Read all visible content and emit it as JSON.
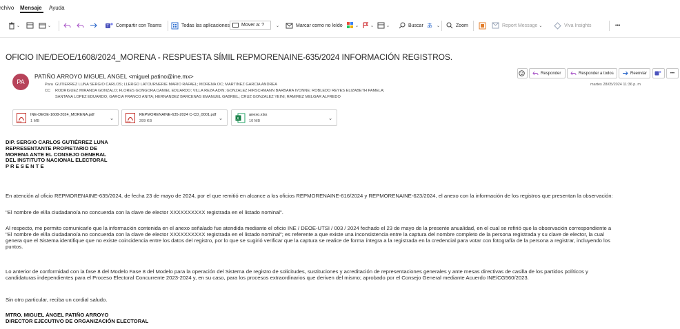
{
  "menu": {
    "items": [
      "rchivo",
      "Mensaje",
      "Ayuda"
    ]
  },
  "ribbon": {
    "teams": "Compartir con Teams",
    "apps": "Todas las aplicaciones",
    "move": "Mover a: ?",
    "mark": "Marcar como no leído",
    "search": "Buscar",
    "zoom": "Zoom",
    "report": "Report Message",
    "insights": "Viva Insights",
    "more": "•••"
  },
  "email": {
    "subject": "OFICIO INE/DEOE/1608/2024_MORENA - RESPUESTA SÍMIL REPMORENAINE-635/2024 INFORMACIÓN REGISTROS.",
    "avatar_initials": "PA",
    "from": "PATIÑO ARROYO MIGUEL ANGEL <miguel.patino@ine.mx>",
    "to_label": "Para",
    "to": "GUTIERREZ LUNA SERGIO CARLOS; LLERGO LATOURNERIE MARIO RAFAEL; MORENA OC; MARTINEZ GARCIA ANDREA",
    "cc_label": "CC",
    "cc_line1": "RODRIGUEZ MIRANDA GONZALO; FLORES GONGORA DANIEL EDUARDO; VILLA REZA ADIN; GONZALEZ HIRSCHMANN BARBARA IVONNE; ROBLEDO REYES ELIZABETH PAMELA;",
    "cc_line2": "SANTANA LOPEZ EDUARDO; GARCIA FRANCO ANITA; HERNANDEZ BARCENAS EMANUEL GABRIEL; CRUZ GONZALEZ YEINI; RAMIREZ MELGAR ALFREDO",
    "datetime": "martes 28/05/2024 11:36 p. m",
    "actions": {
      "reply": "Responder",
      "reply_all": "Responder a todos",
      "forward": "Reenviar",
      "more": "•••"
    },
    "attachments": [
      {
        "name": "INE-DEOE-1608-2024_MORENA.pdf",
        "size": "1 MB",
        "type": "pdf"
      },
      {
        "name": "REPMORENAINE-635-2024 C-CD_0001.pdf",
        "size": "289 KB",
        "type": "pdf"
      },
      {
        "name": "anexo.xlsx",
        "size": "10 MB",
        "type": "xlsx"
      }
    ],
    "body": {
      "addressee": [
        "DIP. SERGIO CARLOS GUTIÉRREZ LUNA",
        "REPRESENTANTE PROPIETARIO DE",
        "MORENA ANTE EL CONSEJO GENERAL",
        "DEL INSTITUTO NACIONAL ELECTORAL",
        "P R E S E N T E"
      ],
      "p1": "En atención al oficio REPMORENAINE-635/2024, de fecha 23 de mayo de 2024, por el que remitió en alcance a los oficios REPMORENAINE-616/2024 y REPMORENAINE-623/2024, el anexo con la información de los registros que presentan la observación:",
      "p2": "\"El nombre de el/la ciudadano/a no concuerda con la clave de elector XXXXXXXXXX registrada en el listado nominal\".",
      "p3": [
        "Al respecto, me permito comunicarle que la información contenida en el anexo señalado fue atendida mediante el oficio INE / DEOE-UTSI / 003 / 2024 fechado el 23 de mayo de la presente anualidad, en el cual se refirió que la observación correspondiente a",
        "\"El nombre de el/la ciudadano/a no concuerda con la clave de elector XXXXXXXXXX registrada en el listado nominal\"; es referente a que existe una inconsistencia entre la captura del nombre completo de la persona registrada y su clave de elector, la cual",
        "genera que el Sistema identifique que no existe coincidencia entre los datos del registro, por lo que se sugirió verificar que la captura se realice de forma íntegra a la registrada en la credencial para votar con fotografía de la persona a registrar, incluyendo los",
        "puntos."
      ],
      "p4": [
        "Lo anterior de conformidad con la fase 8 del Modelo Fase 8 del Modelo para la operación del Sistema de registro de solicitudes, sustituciones y acreditación de representaciones generales y ante mesas directivas de casilla de los partidos políticos y",
        "candidaturas independientes para el Proceso Electoral Concurrente 2023-2024 y, en su caso, para los procesos extraordinarios que deriven del mismo; aprobado por el Consejo General mediante Acuerdo INE/CG560/2023."
      ],
      "p5": "Sin otro particular, reciba un cordial saludo.",
      "signature": [
        "MTRO. MIGUEL ÁNGEL PATIÑO ARROYO",
        "DIRECTOR EJECUTIVO DE ORGANIZACIÓN ELECTORAL"
      ]
    }
  }
}
